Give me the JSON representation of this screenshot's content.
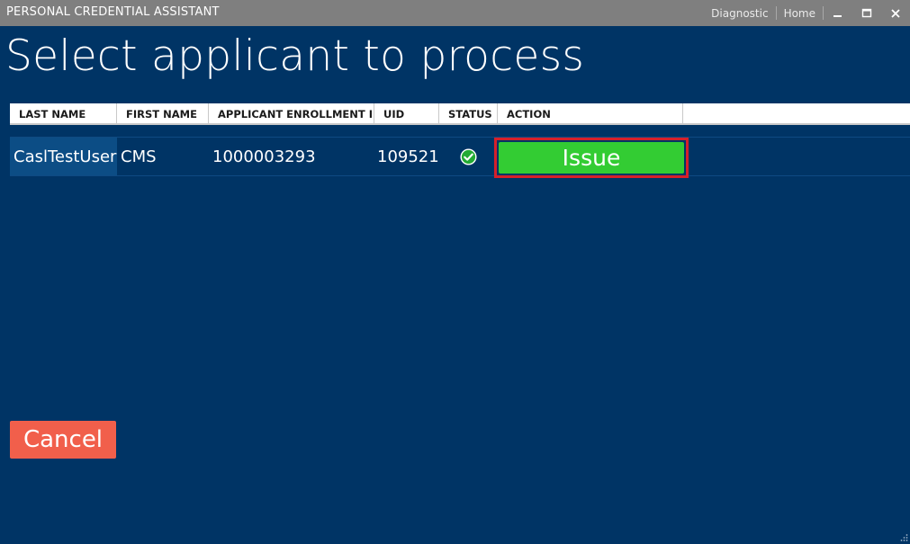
{
  "window": {
    "app_title": "PERSONAL CREDENTIAL ASSISTANT",
    "links": {
      "diagnostic": "Diagnostic",
      "home": "Home"
    },
    "controls": [
      "minimize-icon",
      "maximize-icon",
      "close-icon"
    ]
  },
  "page": {
    "title": "Select applicant to process"
  },
  "table": {
    "columns": [
      "LAST NAME",
      "FIRST NAME",
      "APPLICANT ENROLLMENT ID",
      "UID",
      "STATUS",
      "ACTION"
    ],
    "rows": [
      {
        "last_name": "CaslTestUser",
        "first_name": "CMS",
        "enrollment_id": "1000003293",
        "uid": "109521",
        "status_icon": "check-circle-icon",
        "action_label": "Issue"
      }
    ]
  },
  "footer": {
    "cancel_label": "Cancel"
  },
  "colors": {
    "background": "#003465",
    "titlebar": "#7f7f7f",
    "issue_button": "#33cc33",
    "issue_highlight": "#d7202a",
    "cancel_button": "#f15f4b",
    "selected_cell": "#0c4d85",
    "status_ok": "#22aa33"
  }
}
